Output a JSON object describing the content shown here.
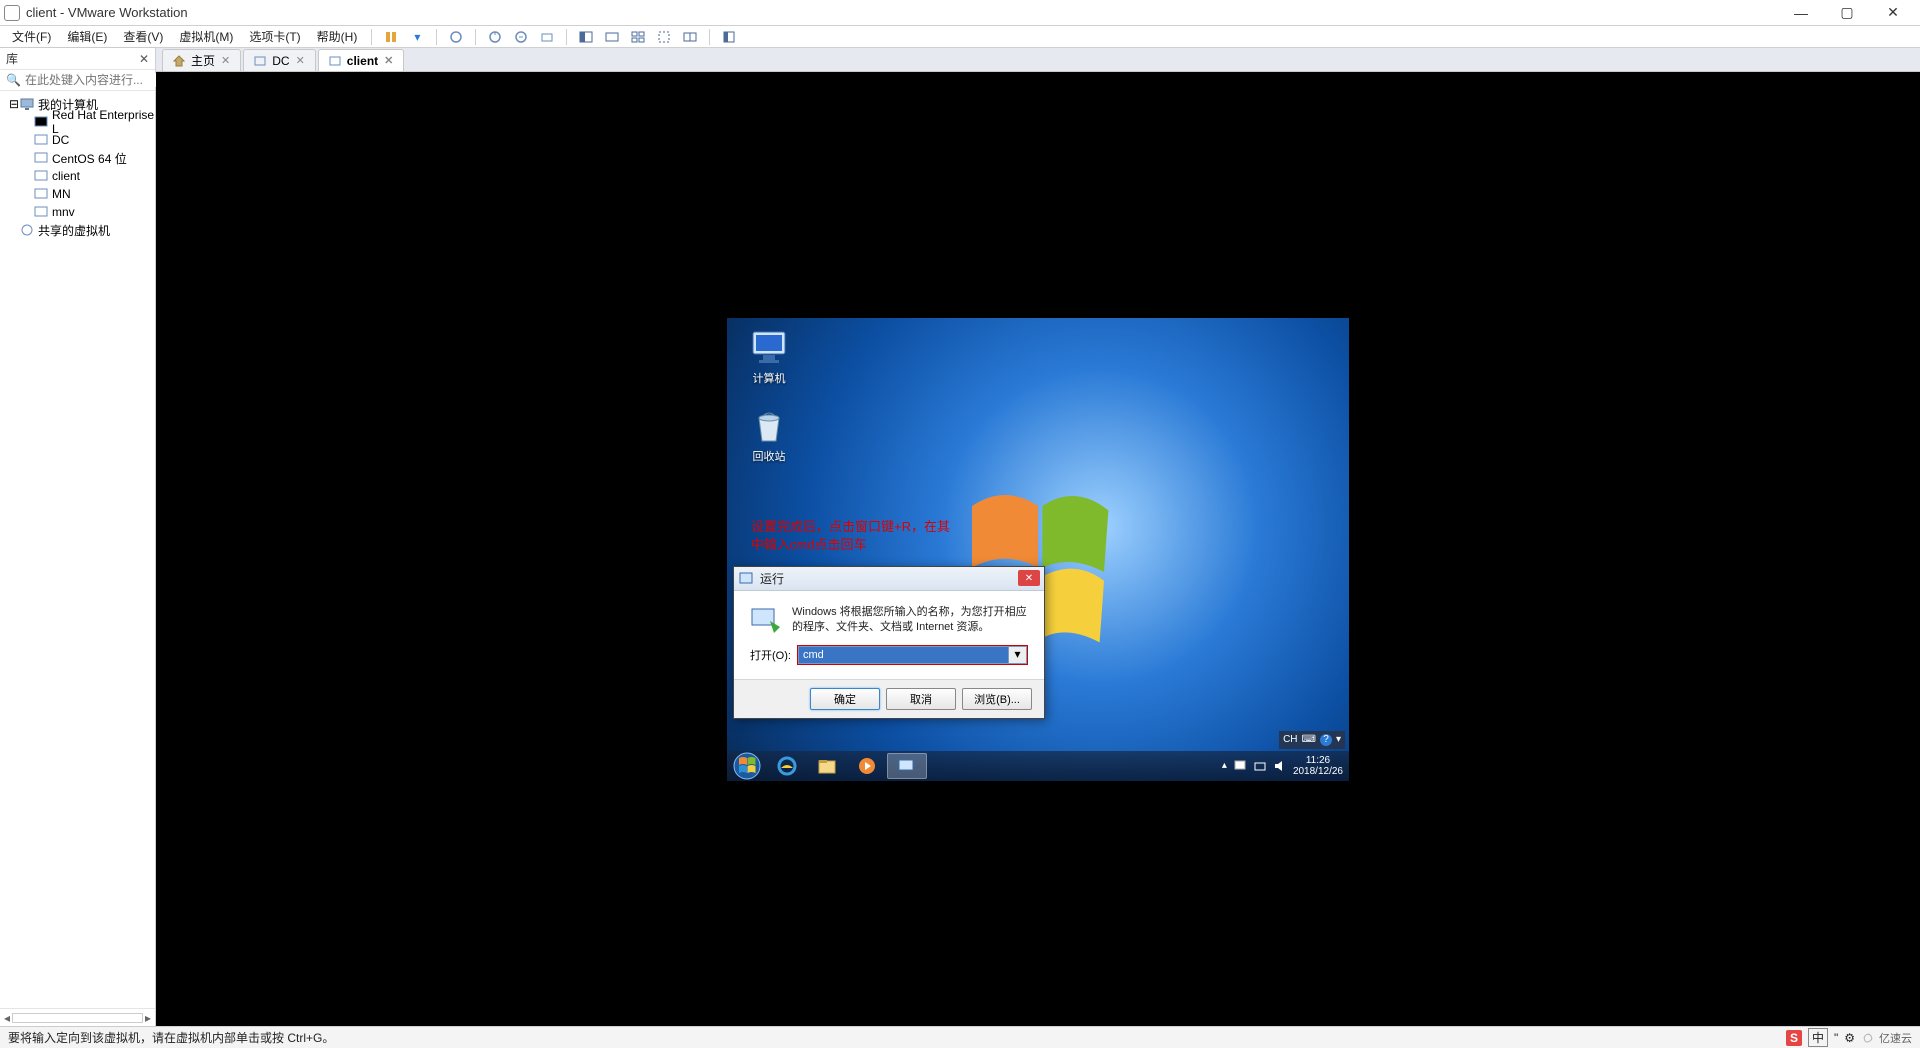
{
  "titlebar": {
    "title": "client - VMware Workstation"
  },
  "menubar": {
    "file": "文件(F)",
    "edit": "编辑(E)",
    "view": "查看(V)",
    "vm": "虚拟机(M)",
    "tabs": "选项卡(T)",
    "help": "帮助(H)"
  },
  "sidebar": {
    "header": "库",
    "search_placeholder": "在此处键入内容进行...",
    "root": "我的计算机",
    "items": [
      {
        "label": "Red Hat Enterprise L"
      },
      {
        "label": "DC"
      },
      {
        "label": "CentOS 64 位"
      },
      {
        "label": "client"
      },
      {
        "label": "MN"
      },
      {
        "label": "mnv"
      }
    ],
    "shared": "共享的虚拟机"
  },
  "tabs": {
    "home": "主页",
    "dc": "DC",
    "client": "client"
  },
  "guest": {
    "desktop_icons": {
      "computer": "计算机",
      "recycle": "回收站"
    },
    "annotation": "设置完成后，点击窗口键+R，在其中输入cmd点击回车",
    "run_dialog": {
      "title": "运行",
      "description": "Windows 将根据您所输入的名称，为您打开相应的程序、文件夹、文档或 Internet 资源。",
      "open_label": "打开(O):",
      "value": "cmd",
      "ok": "确定",
      "cancel": "取消",
      "browse": "浏览(B)..."
    },
    "langbar": {
      "lang": "CH"
    },
    "tray": {
      "time": "11:26",
      "date": "2018/12/26"
    }
  },
  "statusbar": {
    "text": "要将输入定向到该虚拟机，请在虚拟机内部单击或按 Ctrl+G。",
    "brand": "亿速云",
    "ime": "中"
  }
}
